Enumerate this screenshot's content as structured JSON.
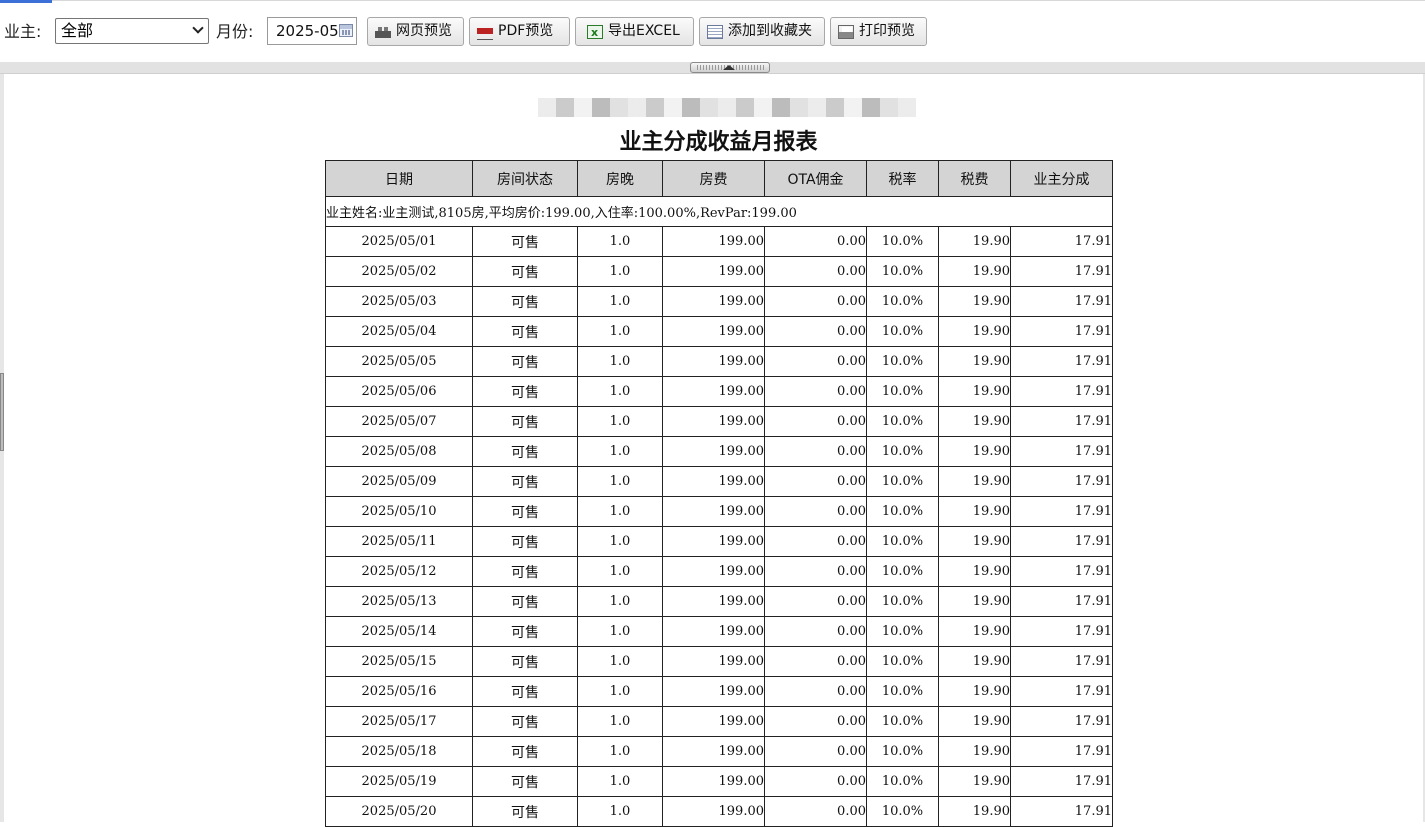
{
  "toolbar": {
    "owner_label": "业主:",
    "owner_selected": "全部",
    "month_label": "月份:",
    "month_value": "2025-05",
    "buttons": {
      "web_preview": "网页预览",
      "pdf_preview": "PDF预览",
      "export_excel": "导出EXCEL",
      "add_favorites": "添加到收藏夹",
      "print_preview": "打印预览"
    }
  },
  "report": {
    "title": "业主分成收益月报表",
    "columns": [
      "日期",
      "房间状态",
      "房晚",
      "房费",
      "OTA佣金",
      "税率",
      "税费",
      "业主分成"
    ],
    "owner_info": "业主姓名:业主测试,8105房,平均房价:199.00,入住率:100.00%,RevPar:199.00",
    "rows": [
      [
        "2025/05/01",
        "可售",
        "1.0",
        "199.00",
        "0.00",
        "10.0%",
        "19.90",
        "17.91"
      ],
      [
        "2025/05/02",
        "可售",
        "1.0",
        "199.00",
        "0.00",
        "10.0%",
        "19.90",
        "17.91"
      ],
      [
        "2025/05/03",
        "可售",
        "1.0",
        "199.00",
        "0.00",
        "10.0%",
        "19.90",
        "17.91"
      ],
      [
        "2025/05/04",
        "可售",
        "1.0",
        "199.00",
        "0.00",
        "10.0%",
        "19.90",
        "17.91"
      ],
      [
        "2025/05/05",
        "可售",
        "1.0",
        "199.00",
        "0.00",
        "10.0%",
        "19.90",
        "17.91"
      ],
      [
        "2025/05/06",
        "可售",
        "1.0",
        "199.00",
        "0.00",
        "10.0%",
        "19.90",
        "17.91"
      ],
      [
        "2025/05/07",
        "可售",
        "1.0",
        "199.00",
        "0.00",
        "10.0%",
        "19.90",
        "17.91"
      ],
      [
        "2025/05/08",
        "可售",
        "1.0",
        "199.00",
        "0.00",
        "10.0%",
        "19.90",
        "17.91"
      ],
      [
        "2025/05/09",
        "可售",
        "1.0",
        "199.00",
        "0.00",
        "10.0%",
        "19.90",
        "17.91"
      ],
      [
        "2025/05/10",
        "可售",
        "1.0",
        "199.00",
        "0.00",
        "10.0%",
        "19.90",
        "17.91"
      ],
      [
        "2025/05/11",
        "可售",
        "1.0",
        "199.00",
        "0.00",
        "10.0%",
        "19.90",
        "17.91"
      ],
      [
        "2025/05/12",
        "可售",
        "1.0",
        "199.00",
        "0.00",
        "10.0%",
        "19.90",
        "17.91"
      ],
      [
        "2025/05/13",
        "可售",
        "1.0",
        "199.00",
        "0.00",
        "10.0%",
        "19.90",
        "17.91"
      ],
      [
        "2025/05/14",
        "可售",
        "1.0",
        "199.00",
        "0.00",
        "10.0%",
        "19.90",
        "17.91"
      ],
      [
        "2025/05/15",
        "可售",
        "1.0",
        "199.00",
        "0.00",
        "10.0%",
        "19.90",
        "17.91"
      ],
      [
        "2025/05/16",
        "可售",
        "1.0",
        "199.00",
        "0.00",
        "10.0%",
        "19.90",
        "17.91"
      ],
      [
        "2025/05/17",
        "可售",
        "1.0",
        "199.00",
        "0.00",
        "10.0%",
        "19.90",
        "17.91"
      ],
      [
        "2025/05/18",
        "可售",
        "1.0",
        "199.00",
        "0.00",
        "10.0%",
        "19.90",
        "17.91"
      ],
      [
        "2025/05/19",
        "可售",
        "1.0",
        "199.00",
        "0.00",
        "10.0%",
        "19.90",
        "17.91"
      ],
      [
        "2025/05/20",
        "可售",
        "1.0",
        "199.00",
        "0.00",
        "10.0%",
        "19.90",
        "17.91"
      ]
    ]
  }
}
